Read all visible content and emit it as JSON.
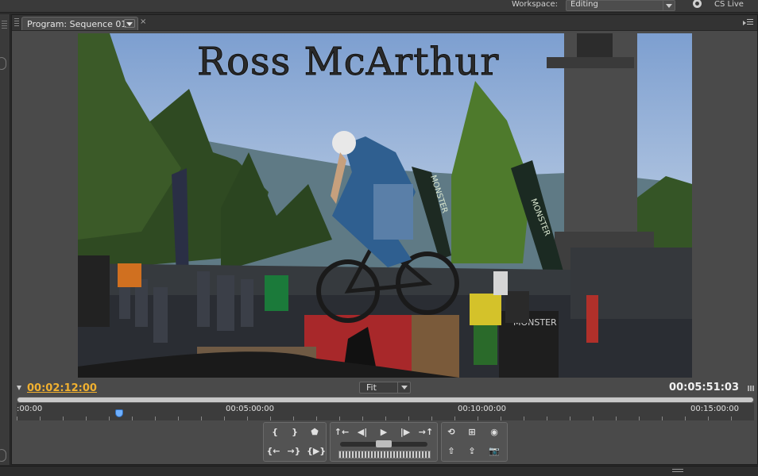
{
  "topbar": {
    "workspace_label": "Workspace:",
    "workspace_value": "Editing",
    "cs_live_label": "CS Live"
  },
  "panel": {
    "tab_title": "Program: Sequence 01",
    "close_glyph": "×"
  },
  "video": {
    "overlay_title": "Ross McArthur",
    "banner_texts": [
      "MONSTER",
      "MONSTER",
      "MONSTER"
    ]
  },
  "transport": {
    "current_timecode": "00:02:12:00",
    "duration_timecode": "00:05:51:03",
    "zoom_value": "Fit",
    "ruler_labels": [
      ":00:00",
      "00:05:00:00",
      "00:10:00:00",
      "00:15:00:00"
    ],
    "playhead_position_fraction": 0.14
  },
  "buttons": {
    "mark_in": "{",
    "mark_out": "}",
    "add_marker": "⬟",
    "go_to_in": "{←",
    "go_to_out": "→}",
    "play_in_to_out": "{▶}",
    "go_prev_edit": "↑←",
    "step_back": "◀|",
    "play": "▶",
    "step_forward": "|▶",
    "go_next_edit": "→↑",
    "loop": "⟲",
    "safe_margins": "⊞",
    "output": "◉",
    "lift": "⇧",
    "extract": "⇪",
    "export_frame": "📷"
  }
}
